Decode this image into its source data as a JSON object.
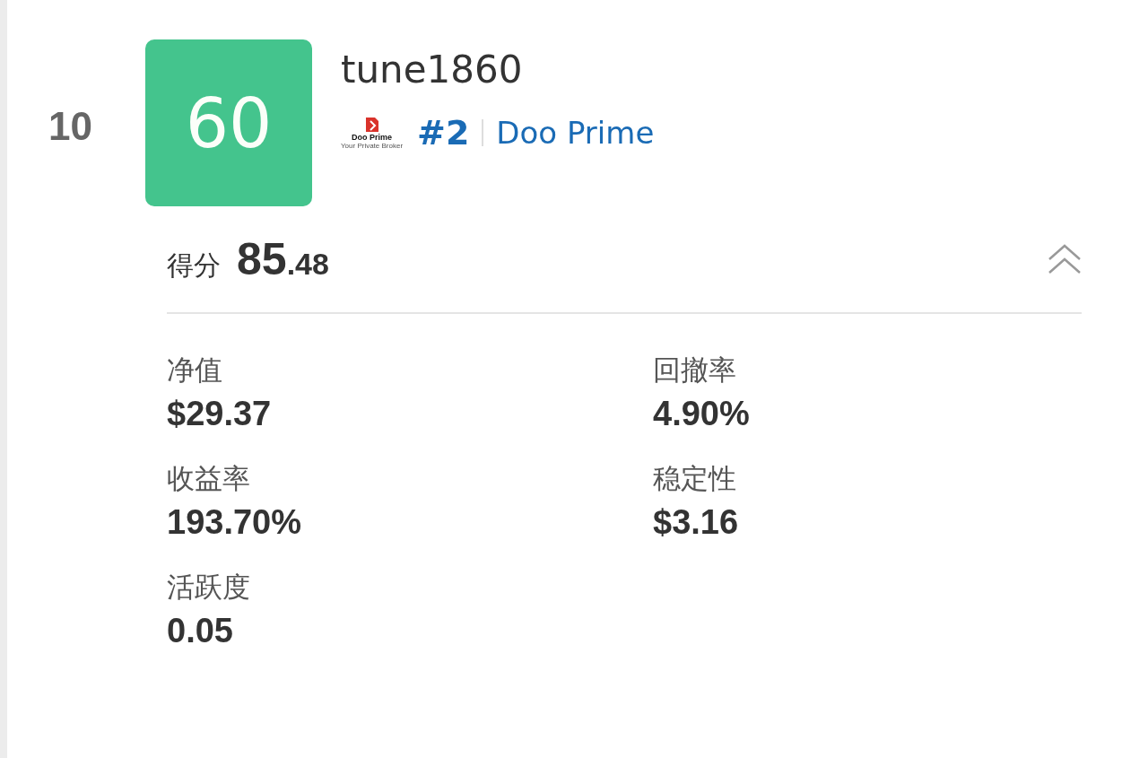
{
  "entry": {
    "rank": "10",
    "avatar": {
      "text": "60",
      "color": "#44c48d"
    },
    "name": "tune1860",
    "broker": {
      "logo_name": "Doo Prime",
      "logo_tagline": "Your Private Broker",
      "position": "#2",
      "name": "Doo Prime"
    },
    "score": {
      "label": "得分",
      "main": "85",
      "fraction": ".48"
    },
    "expanded": true,
    "stats": [
      {
        "label": "净值",
        "value": "$29.37"
      },
      {
        "label": "回撤率",
        "value": "4.90%"
      },
      {
        "label": "收益率",
        "value": "193.70%"
      },
      {
        "label": "稳定性",
        "value": "$3.16"
      },
      {
        "label": "活跃度",
        "value": "0.05"
      }
    ]
  }
}
